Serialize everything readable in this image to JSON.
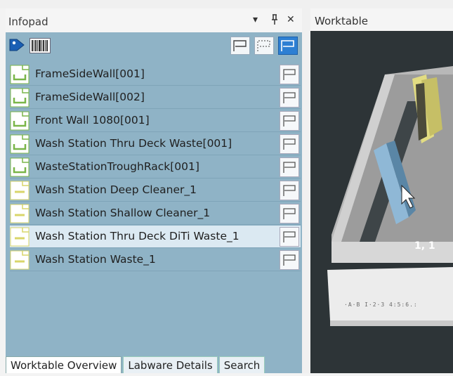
{
  "infopad": {
    "title": "Infopad",
    "header_buttons": [
      "▾",
      "⊓",
      "✕"
    ],
    "toolbar": {
      "icons": [
        "tag-icon",
        "barcode-icon"
      ],
      "flag_buttons": [
        "flag-icon",
        "flag-outline-icon",
        "flag-active-icon"
      ]
    },
    "items": [
      {
        "label": "FrameSideWall[001]",
        "icon": "green-carrier-icon"
      },
      {
        "label": "FrameSideWall[002]",
        "icon": "green-carrier-icon"
      },
      {
        "label": "Front Wall 1080[001]",
        "icon": "green-carrier-icon"
      },
      {
        "label": "Wash Station Thru Deck Waste[001]",
        "icon": "green-carrier-icon"
      },
      {
        "label": "WasteStationTroughRack[001]",
        "icon": "green-carrier-icon"
      },
      {
        "label": "Wash Station Deep Cleaner_1",
        "icon": "yellow-labware-icon"
      },
      {
        "label": "Wash Station Shallow Cleaner_1",
        "icon": "yellow-labware-icon"
      },
      {
        "label": "Wash Station Thru Deck DiTi Waste_1",
        "icon": "yellow-labware-icon",
        "selected": true
      },
      {
        "label": "Wash Station Waste_1",
        "icon": "yellow-labware-icon"
      }
    ],
    "tabs": [
      {
        "label": "Worktable Overview",
        "active": true
      },
      {
        "label": "Labware Details",
        "active": false
      },
      {
        "label": "Search",
        "active": false
      }
    ]
  },
  "worktable": {
    "title": "Worktable",
    "coordinate": "1, 1",
    "deck_label": "·A·B  I·2·3  4:5:6.:"
  },
  "colors": {
    "infopad_bg": "#8fb3c6",
    "selected_row": "#dbe9f2",
    "carrier_green": "#7ab648",
    "labware_yellow": "#d9d66a",
    "worktable_bg": "#2d3437"
  }
}
